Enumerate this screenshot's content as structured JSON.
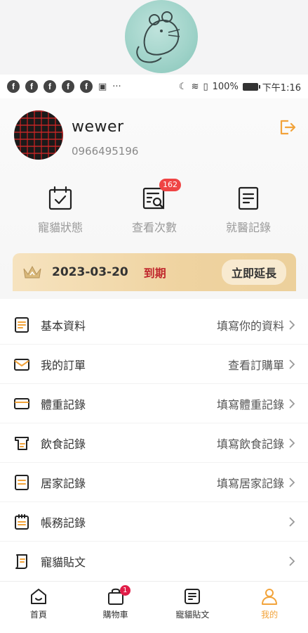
{
  "status_bar": {
    "notification_icons": [
      "facebook-icon",
      "facebook-icon",
      "facebook-icon",
      "facebook-icon",
      "facebook-icon",
      "image-icon"
    ],
    "more": "···",
    "battery_percent": "100%",
    "time": "下午1:16"
  },
  "profile": {
    "username": "wewer",
    "phone": "0966495196"
  },
  "shortcuts": [
    {
      "label": "寵貓狀態",
      "icon": "calendar-check-icon"
    },
    {
      "label": "查看次數",
      "icon": "search-list-icon",
      "badge": "162"
    },
    {
      "label": "就醫記錄",
      "icon": "document-icon"
    }
  ],
  "membership": {
    "date": "2023-03-20",
    "status": "到期",
    "extend_label": "立即延長"
  },
  "menu": [
    {
      "label": "基本資料",
      "action": "填寫你的資料"
    },
    {
      "label": "我的訂單",
      "action": "查看訂購單"
    },
    {
      "label": "體重記錄",
      "action": "填寫體重記錄"
    },
    {
      "label": "飲食記錄",
      "action": "填寫飲食記錄"
    },
    {
      "label": "居家記錄",
      "action": "填寫居家記錄"
    },
    {
      "label": "帳務記錄",
      "action": ""
    },
    {
      "label": "寵貓貼文",
      "action": ""
    }
  ],
  "bottom_nav": [
    {
      "label": "首頁",
      "icon": "home-icon"
    },
    {
      "label": "購物車",
      "icon": "shopping-bag-icon",
      "badge": "1"
    },
    {
      "label": "寵貓貼文",
      "icon": "post-icon"
    },
    {
      "label": "我的",
      "icon": "profile-icon",
      "active": true
    }
  ],
  "colors": {
    "accent": "#f2a33a",
    "expired": "#c0282d",
    "membership_bg": "#efd3a0"
  }
}
